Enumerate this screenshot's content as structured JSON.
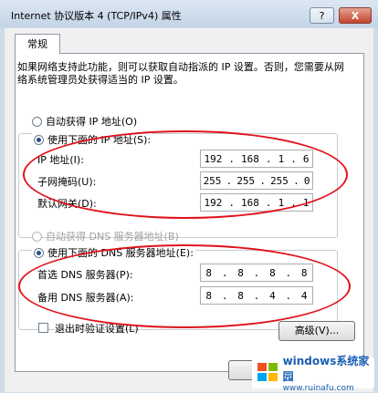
{
  "window": {
    "title": "Internet 协议版本 4 (TCP/IPv4) 属性",
    "help_label": "?",
    "close_label": "X"
  },
  "tab": {
    "label": "常规"
  },
  "description": "如果网络支持此功能，则可以获取自动指派的 IP 设置。否则，您需要从网络系统管理员处获得适当的 IP 设置。",
  "ip": {
    "auto_label": "自动获得 IP 地址(O)",
    "manual_label": "使用下面的 IP 地址(S):",
    "selected": "manual",
    "fields": [
      {
        "label": "IP 地址(I):",
        "parts": [
          "192",
          "168",
          "1",
          "6"
        ]
      },
      {
        "label": "子网掩码(U):",
        "parts": [
          "255",
          "255",
          "255",
          "0"
        ]
      },
      {
        "label": "默认网关(D):",
        "parts": [
          "192",
          "168",
          "1",
          "1"
        ]
      }
    ]
  },
  "dns": {
    "auto_label": "自动获得 DNS 服务器地址(B)",
    "manual_label": "使用下面的 DNS 服务器地址(E):",
    "selected": "manual",
    "fields": [
      {
        "label": "首选 DNS 服务器(P):",
        "parts": [
          "8",
          "8",
          "8",
          "8"
        ]
      },
      {
        "label": "备用 DNS 服务器(A):",
        "parts": [
          "8",
          "8",
          "4",
          "4"
        ]
      }
    ]
  },
  "validate_label": "退出时验证设置(L)",
  "validate_checked": false,
  "advanced_label": "高级(V)...",
  "ok_label": "",
  "watermark": {
    "brand": "windows系统家园",
    "url": "www.ruinafu.com"
  },
  "colors": {
    "annotation": "#e0121b",
    "accent": "#1f4f8f"
  }
}
